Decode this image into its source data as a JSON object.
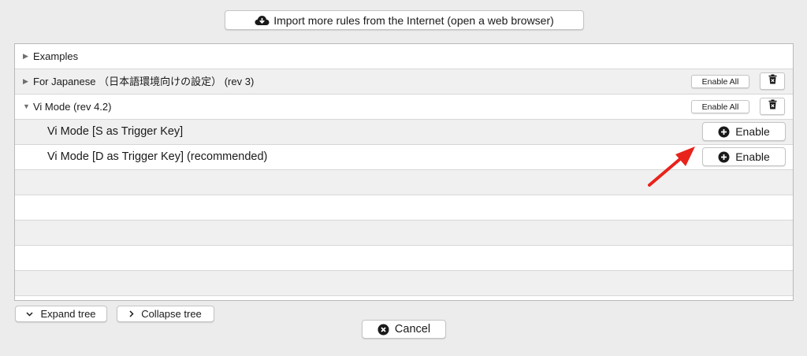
{
  "import_button": {
    "label": "Import more rules from the Internet (open a web browser)",
    "icon": "cloud-download-icon"
  },
  "tree": {
    "groups": [
      {
        "label": "Examples",
        "expanded": false
      },
      {
        "label": "For Japanese （日本語環境向けの設定） (rev 3)",
        "expanded": false,
        "enable_all": "Enable All",
        "delete_icon": "trash-icon"
      },
      {
        "label": "Vi Mode (rev 4.2)",
        "expanded": true,
        "enable_all": "Enable All",
        "delete_icon": "trash-icon"
      }
    ],
    "rules": [
      {
        "label": "Vi Mode [S as Trigger Key]",
        "enable": "Enable"
      },
      {
        "label": "Vi Mode [D as Trigger Key] (recommended)",
        "enable": "Enable"
      }
    ]
  },
  "annotation": {
    "type": "arrow",
    "color": "#e8231c"
  },
  "footer": {
    "expand_tree": "Expand tree",
    "collapse_tree": "Collapse tree",
    "cancel": "Cancel"
  }
}
